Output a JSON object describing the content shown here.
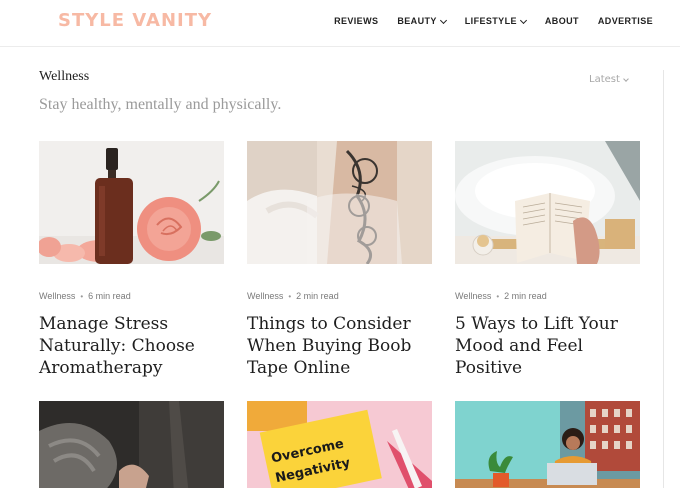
{
  "header": {
    "logo": "STYLE VANITY",
    "nav": [
      {
        "label": "REVIEWS",
        "dropdown": false
      },
      {
        "label": "BEAUTY",
        "dropdown": true
      },
      {
        "label": "LIFESTYLE",
        "dropdown": true
      },
      {
        "label": "ABOUT",
        "dropdown": false
      },
      {
        "label": "ADVERTISE",
        "dropdown": false
      }
    ]
  },
  "page": {
    "title": "Wellness",
    "subtitle": "Stay healthy, mentally and physically.",
    "sort_label": "Latest"
  },
  "articles": [
    {
      "category": "Wellness",
      "read_time": "6 min read",
      "title": "Manage Stress Naturally: Choose Aromatherapy"
    },
    {
      "category": "Wellness",
      "read_time": "2 min read",
      "title": "Things to Consider When Buying Boob Tape Online"
    },
    {
      "category": "Wellness",
      "read_time": "2 min read",
      "title": "5 Ways to Lift Your Mood and Feel Positive"
    }
  ],
  "row2_images": [
    {
      "text": ""
    },
    {
      "text": "Overcome Negativity"
    },
    {
      "text": ""
    }
  ],
  "colors": {
    "logo": "#f7b9a4",
    "subtitle": "#9a9a9a",
    "meta": "#7a7a7a"
  }
}
